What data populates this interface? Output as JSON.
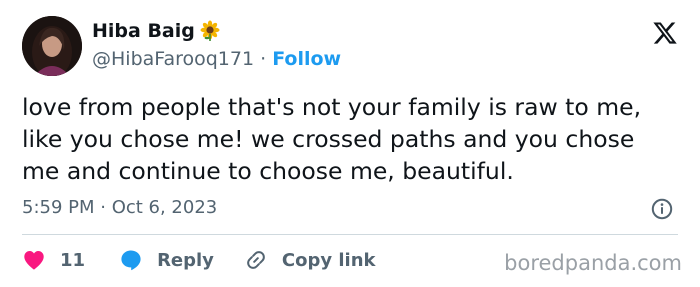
{
  "author": {
    "display_name": "Hiba Baig",
    "name_emoji_icon": "sunflower-icon",
    "handle": "@HibaFarooq171",
    "separator": "·",
    "follow_label": "Follow"
  },
  "tweet": {
    "text": "love from people that's not your family is raw to me, like you chose me! we crossed paths and you chose me and continue to choose me, beautiful.",
    "timestamp": "5:59 PM · Oct 6, 2023"
  },
  "actions": {
    "like_count": "11",
    "reply_label": "Reply",
    "copy_link_label": "Copy link"
  },
  "watermark": "boredpanda.com",
  "colors": {
    "accent_blue": "#1d9bf0",
    "like_pink": "#f91880",
    "secondary_text": "#536471",
    "primary_text": "#0f1419"
  },
  "icons": [
    "x-logo-icon",
    "info-icon",
    "heart-icon",
    "reply-bubble-icon",
    "link-icon",
    "sunflower-icon"
  ]
}
